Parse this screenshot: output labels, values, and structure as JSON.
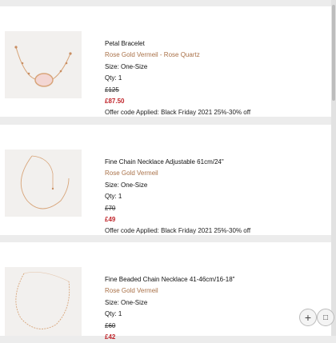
{
  "items": [
    {
      "name": "Petal Bracelet",
      "variant": "Rose Gold Vermeil - Rose Quartz",
      "size": "Size: One-Size",
      "qty": "Qty: 1",
      "original_price": "£125",
      "sale_price": "£87.50",
      "offer": "Offer code Applied: Black Friday 2021 25%-30% off"
    },
    {
      "name": "Fine Chain Necklace Adjustable 61cm/24\"",
      "variant": "Rose Gold Vermeil",
      "size": "Size: One-Size",
      "qty": "Qty: 1",
      "original_price": "£70",
      "sale_price": "£49",
      "offer": "Offer code Applied: Black Friday 2021 25%-30% off"
    },
    {
      "name": "Fine Beaded Chain Necklace 41-46cm/16-18\"",
      "variant": "Rose Gold Vermeil",
      "size": "Size: One-Size",
      "qty": "Qty: 1",
      "original_price": "£60",
      "sale_price": "£42"
    }
  ],
  "colors": {
    "accent": "#a97148",
    "sale": "#c0262c",
    "background": "#ececec"
  },
  "icons": {
    "zoom": "plus-icon",
    "copy": "copy-icon"
  }
}
